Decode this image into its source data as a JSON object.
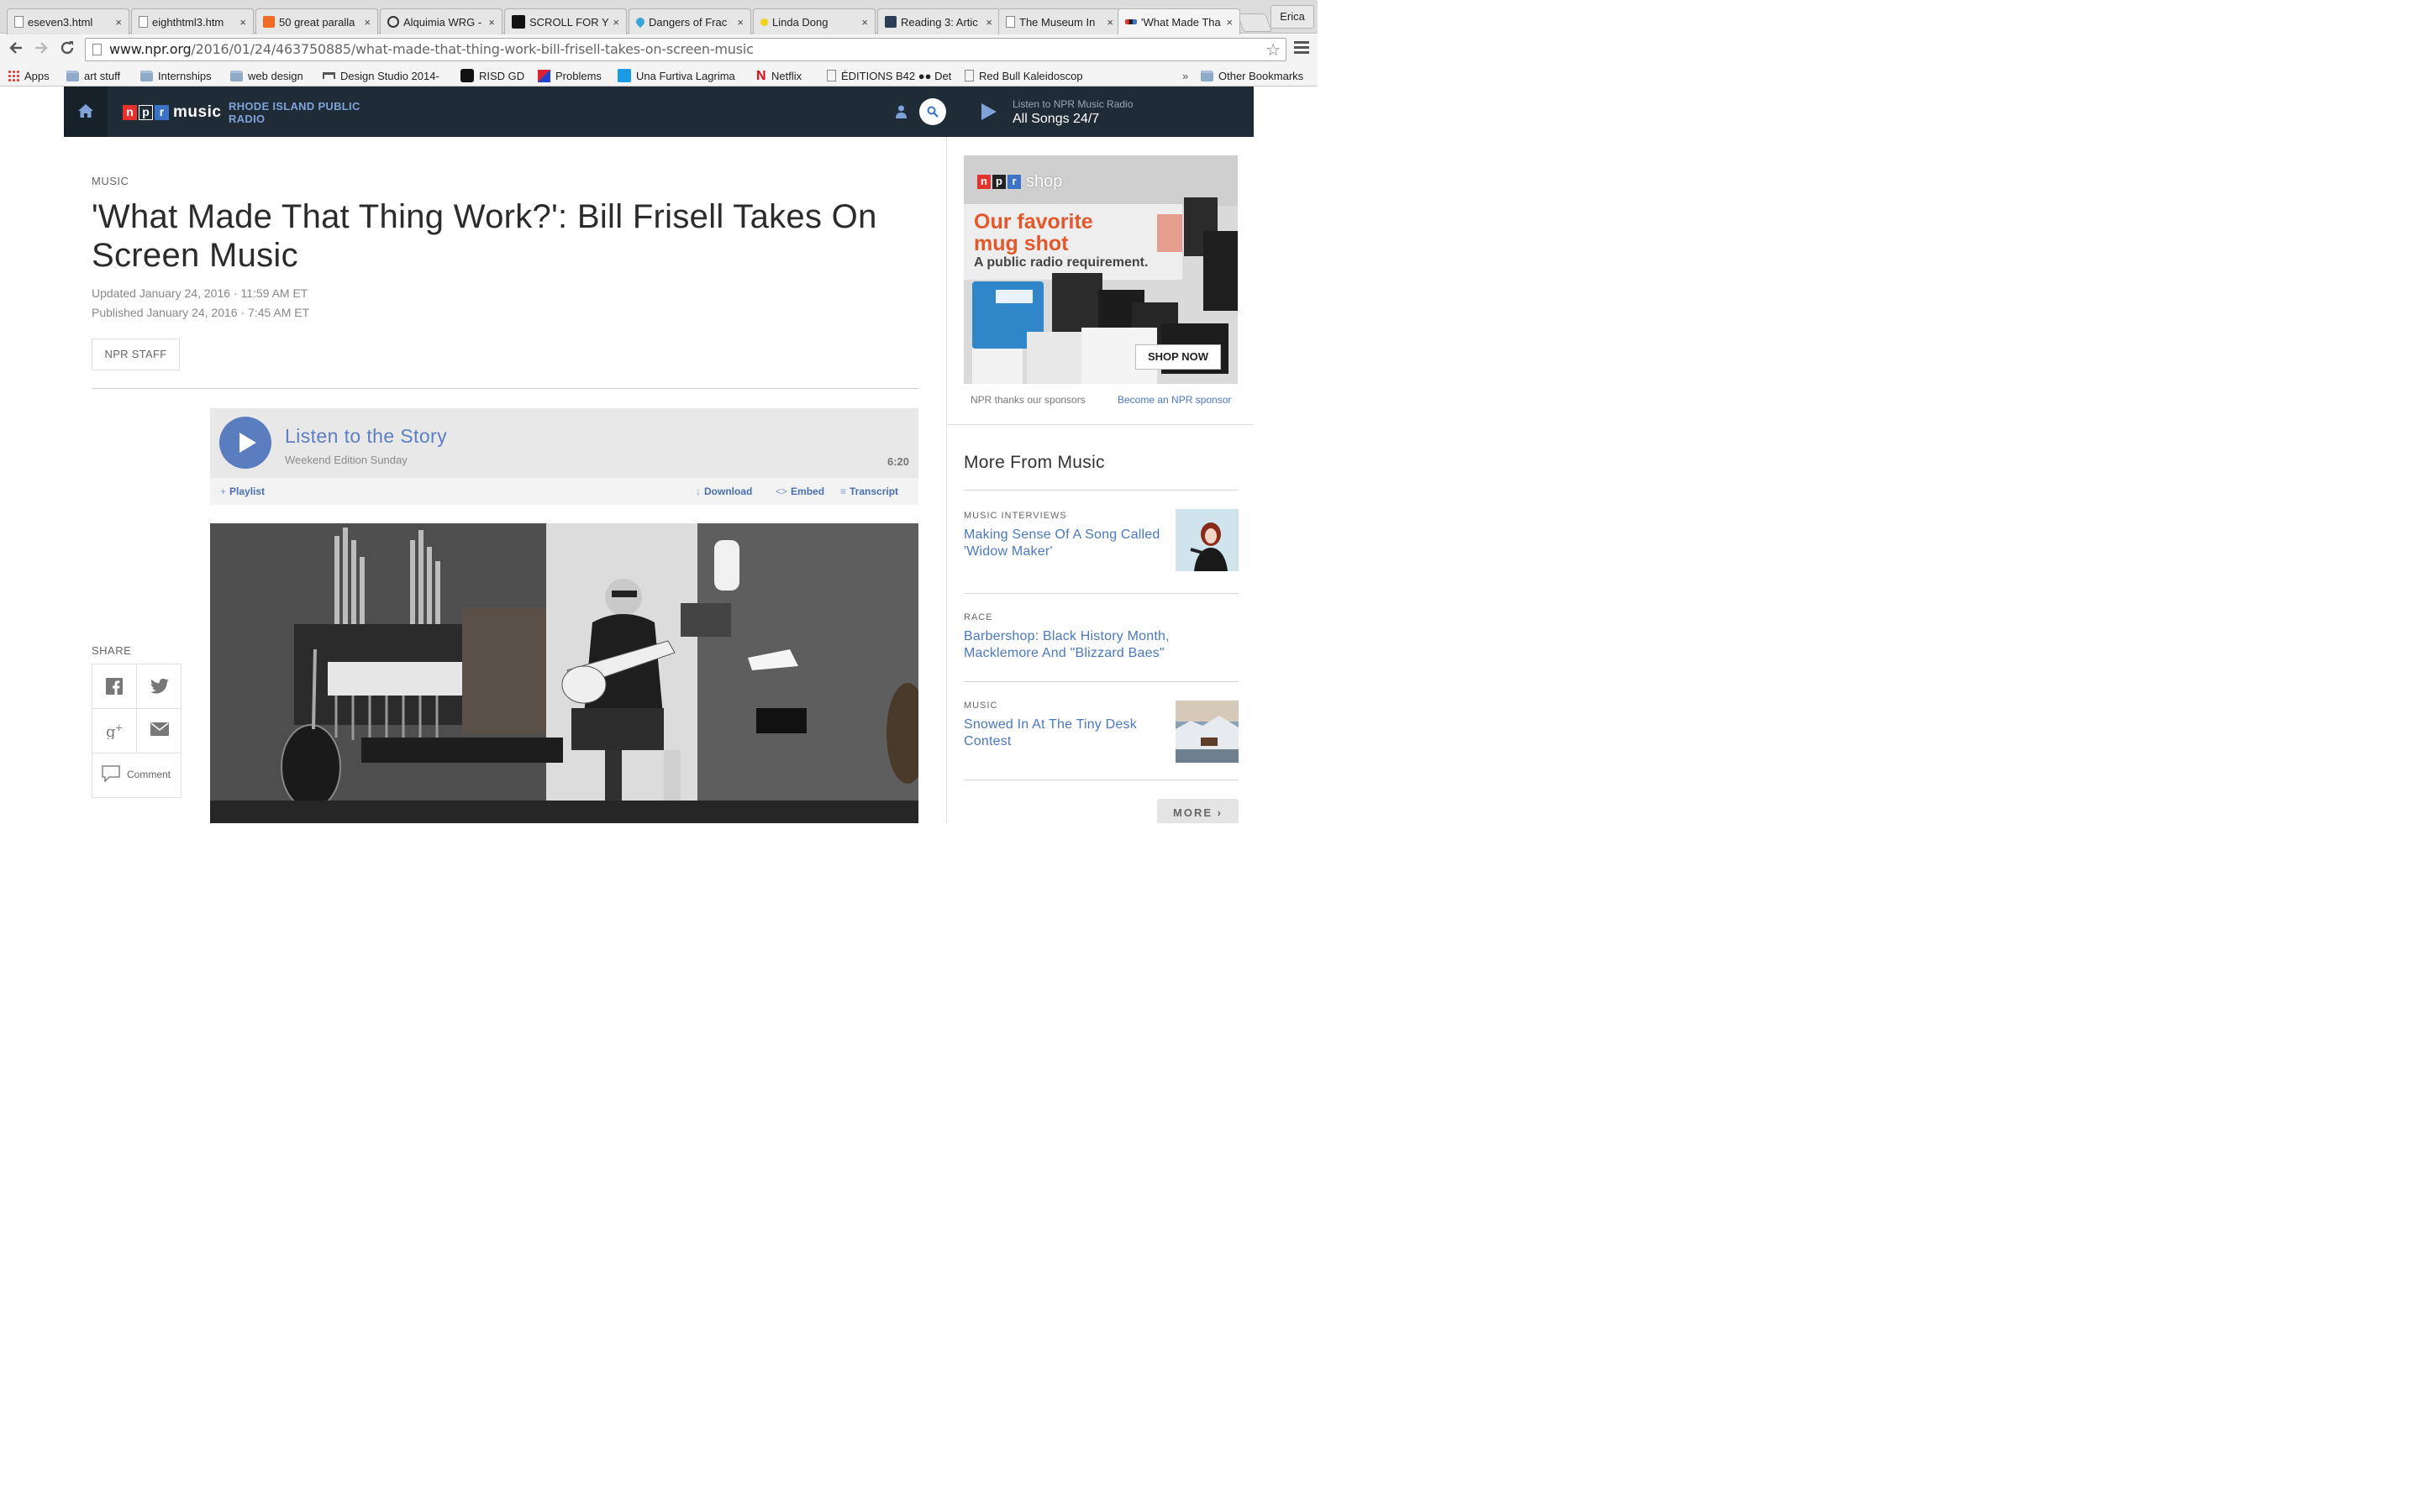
{
  "browser": {
    "tabs": [
      {
        "title": "eseven3.html",
        "icon": "page-icon",
        "active": false
      },
      {
        "title": "eighthtml3.htm",
        "icon": "page-icon",
        "active": false
      },
      {
        "title": "50 great paralla",
        "icon": "site-orange-icon",
        "active": false
      },
      {
        "title": "Alquimia WRG -",
        "icon": "circle-logo-icon",
        "active": false
      },
      {
        "title": "SCROLL FOR YO",
        "icon": "u-logo-icon",
        "active": false
      },
      {
        "title": "Dangers of Frac",
        "icon": "water-drop-icon",
        "active": false
      },
      {
        "title": "Linda Dong",
        "icon": "yellow-dot-icon",
        "active": false
      },
      {
        "title": "Reading 3: Artic",
        "icon": "jh-logo-icon",
        "active": false
      },
      {
        "title": "The Museum In",
        "icon": "page-icon",
        "active": false
      },
      {
        "title": "'What Made Tha",
        "icon": "npr-icon",
        "active": true
      }
    ],
    "close_glyph": "×",
    "user": "Erica",
    "url_host": "www.npr.org",
    "url_path": "/2016/01/24/463750885/what-made-that-thing-work-bill-frisell-takes-on-screen-music",
    "bookmarks": [
      {
        "label": "Apps",
        "icon": "apps-grid-icon"
      },
      {
        "label": "art stuff",
        "icon": "folder-icon"
      },
      {
        "label": "Internships",
        "icon": "folder-icon"
      },
      {
        "label": "web design",
        "icon": "folder-icon"
      },
      {
        "label": "Design Studio 2014-",
        "icon": "bench-icon"
      },
      {
        "label": "RISD GD",
        "icon": "risd-icon"
      },
      {
        "label": "Problems",
        "icon": "problems-icon"
      },
      {
        "label": "Una Furtiva Lagrima",
        "icon": "play-icon"
      },
      {
        "label": "Netflix",
        "icon": "netflix-icon"
      },
      {
        "label": "ÉDITIONS B42 ●● Det",
        "icon": "page-icon"
      },
      {
        "label": "Red Bull Kaleidoscop",
        "icon": "page-icon"
      }
    ],
    "overflow": "»",
    "other_bookmarks": "Other Bookmarks"
  },
  "npr_header": {
    "logo_letters": [
      "n",
      "p",
      "r"
    ],
    "logo_music": "music",
    "station_line1": "RHODE ISLAND PUBLIC",
    "station_line2": "RADIO",
    "radio_sub": "Listen to NPR Music Radio",
    "radio_main": "All Songs 24/7"
  },
  "article": {
    "kicker": "MUSIC",
    "headline": "'What Made That Thing Work?': Bill Frisell Takes On Screen Music",
    "updated": "Updated January 24, 2016 · 11:59 AM ET",
    "published": "Published January 24, 2016 · 7:45 AM ET",
    "byline": "NPR STAFF"
  },
  "player": {
    "title": "Listen to the Story",
    "show": "Weekend Edition Sunday",
    "duration": "6:20",
    "actions": {
      "playlist": "Playlist",
      "download": "Download",
      "embed": "Embed",
      "transcript": "Transcript"
    }
  },
  "share": {
    "label": "SHARE",
    "comment": "Comment"
  },
  "sidebar": {
    "ad": {
      "logo_letters": [
        "n",
        "p",
        "r"
      ],
      "shop": "shop",
      "headline_1": "Our favorite",
      "headline_2": "mug shot",
      "tagline": "A public radio requirement.",
      "cta": "SHOP NOW"
    },
    "sponsor_thanks": "NPR thanks our sponsors",
    "become_sponsor": "Become an NPR sponsor",
    "more_heading": "More From Music",
    "stories": [
      {
        "category": "MUSIC INTERVIEWS",
        "title": "Making Sense Of A Song Called 'Widow Maker'"
      },
      {
        "category": "RACE",
        "title": "Barbershop: Black History Month, Macklemore And \"Blizzard Baes\""
      },
      {
        "category": "MUSIC",
        "title": "Snowed In At The Tiny Desk Contest"
      }
    ],
    "more_button": "MORE"
  },
  "colors": {
    "npr_bar": "#1f2b36",
    "link_blue": "#4a78c2",
    "npr_red": "#e5322d",
    "npr_blue": "#3a73c8",
    "ad_orange": "#e3582b"
  }
}
